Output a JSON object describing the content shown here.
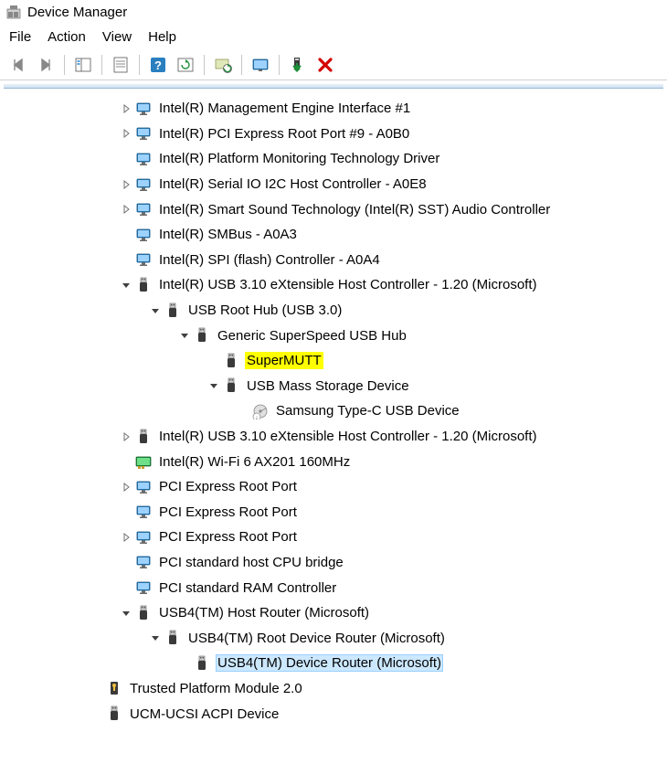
{
  "window": {
    "title": "Device Manager"
  },
  "menu": {
    "file": "File",
    "action": "Action",
    "view": "View",
    "help": "Help"
  },
  "toolbar": {
    "back": "Back",
    "forward": "Forward",
    "show_hide_tree": "Show/Hide Console Tree",
    "properties": "Properties",
    "help": "Help",
    "refresh": "Refresh",
    "scan": "Scan for hardware changes",
    "monitor": "View",
    "install": "Add legacy hardware",
    "delete": "Uninstall device"
  },
  "tree": [
    {
      "indent": 0,
      "exp": "collapsed",
      "icon": "monitor",
      "label": "Intel(R) Management Engine Interface #1"
    },
    {
      "indent": 0,
      "exp": "collapsed",
      "icon": "monitor",
      "label": "Intel(R) PCI Express Root Port #9 - A0B0"
    },
    {
      "indent": 0,
      "exp": "none",
      "icon": "monitor",
      "label": "Intel(R) Platform Monitoring Technology Driver"
    },
    {
      "indent": 0,
      "exp": "collapsed",
      "icon": "monitor",
      "label": "Intel(R) Serial IO I2C Host Controller - A0E8"
    },
    {
      "indent": 0,
      "exp": "collapsed",
      "icon": "monitor",
      "label": "Intel(R) Smart Sound Technology (Intel(R) SST) Audio Controller"
    },
    {
      "indent": 0,
      "exp": "none",
      "icon": "monitor",
      "label": "Intel(R) SMBus - A0A3"
    },
    {
      "indent": 0,
      "exp": "none",
      "icon": "monitor",
      "label": "Intel(R) SPI (flash) Controller - A0A4"
    },
    {
      "indent": 0,
      "exp": "expanded",
      "icon": "usb",
      "label": "Intel(R) USB 3.10 eXtensible Host Controller - 1.20 (Microsoft)"
    },
    {
      "indent": 1,
      "exp": "expanded",
      "icon": "usb",
      "label": "USB Root Hub (USB 3.0)"
    },
    {
      "indent": 2,
      "exp": "expanded",
      "icon": "usb",
      "label": "Generic SuperSpeed USB Hub"
    },
    {
      "indent": 3,
      "exp": "none",
      "icon": "usb",
      "label": "SuperMUTT",
      "highlight": "yellow"
    },
    {
      "indent": 3,
      "exp": "expanded",
      "icon": "usb",
      "label": "USB Mass Storage Device"
    },
    {
      "indent": 4,
      "exp": "none",
      "icon": "disk",
      "label": "Samsung Type-C USB Device"
    },
    {
      "indent": 0,
      "exp": "collapsed",
      "icon": "usb",
      "label": "Intel(R) USB 3.10 eXtensible Host Controller - 1.20 (Microsoft)"
    },
    {
      "indent": 0,
      "exp": "none",
      "icon": "netcard",
      "label": "Intel(R) Wi-Fi 6 AX201 160MHz"
    },
    {
      "indent": 0,
      "exp": "collapsed",
      "icon": "monitor",
      "label": "PCI Express Root Port"
    },
    {
      "indent": 0,
      "exp": "none",
      "icon": "monitor",
      "label": "PCI Express Root Port"
    },
    {
      "indent": 0,
      "exp": "collapsed",
      "icon": "monitor",
      "label": "PCI Express Root Port"
    },
    {
      "indent": 0,
      "exp": "none",
      "icon": "monitor",
      "label": "PCI standard host CPU bridge"
    },
    {
      "indent": 0,
      "exp": "none",
      "icon": "monitor",
      "label": "PCI standard RAM Controller"
    },
    {
      "indent": 0,
      "exp": "expanded",
      "icon": "usb",
      "label": "USB4(TM) Host Router (Microsoft)"
    },
    {
      "indent": 1,
      "exp": "expanded",
      "icon": "usb",
      "label": "USB4(TM) Root Device Router (Microsoft)"
    },
    {
      "indent": 2,
      "exp": "none",
      "icon": "usb",
      "label": "USB4(TM) Device Router (Microsoft)",
      "highlight": "selected"
    },
    {
      "indent": -1,
      "exp": "none",
      "icon": "tpm",
      "label": "Trusted Platform Module 2.0"
    },
    {
      "indent": -1,
      "exp": "none",
      "icon": "usb",
      "label": "UCM-UCSI ACPI Device"
    }
  ]
}
